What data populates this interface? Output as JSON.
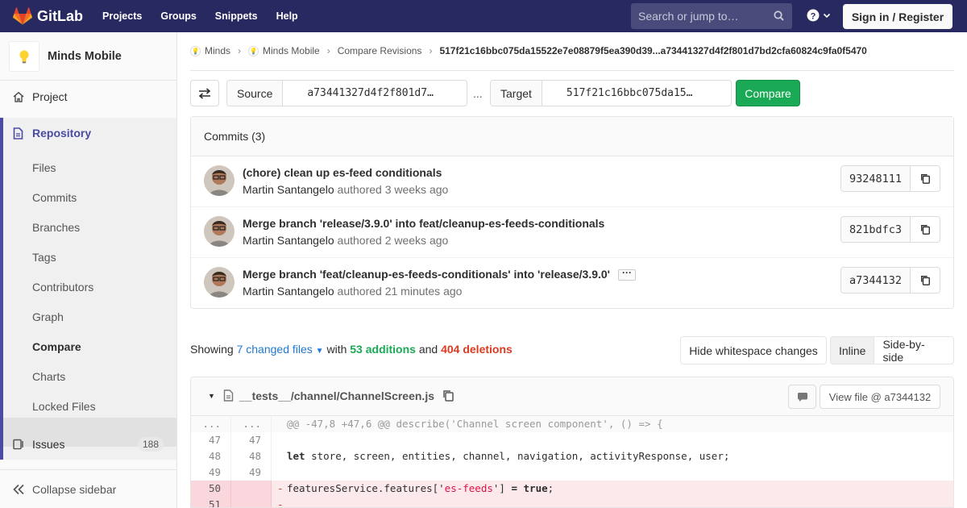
{
  "colors": {
    "topbar": "#292961",
    "accent": "#4b4ba3",
    "compare_btn": "#1aaa55",
    "additions": "#1aaa55",
    "deletions": "#db3b21",
    "link": "#1f78d1"
  },
  "topbar": {
    "brand": "GitLab",
    "nav": [
      "Projects",
      "Groups",
      "Snippets",
      "Help"
    ],
    "search_placeholder": "Search or jump to…",
    "signin": "Sign in / Register"
  },
  "sidebar": {
    "project_name": "Minds Mobile",
    "project": "Project",
    "repository": "Repository",
    "repo_items": [
      "Files",
      "Commits",
      "Branches",
      "Tags",
      "Contributors",
      "Graph",
      "Compare",
      "Charts",
      "Locked Files"
    ],
    "issues": "Issues",
    "issues_count": "188",
    "collapse": "Collapse sidebar"
  },
  "breadcrumb": {
    "items": [
      "Minds",
      "Minds Mobile",
      "Compare Revisions"
    ],
    "current": "517f21c16bbc075da15522e7e08879f5ea390d39...a73441327d4f2f801d7bd2cfa60824c9fa0f5470"
  },
  "compare_form": {
    "source_label": "Source",
    "source_value": "a73441327d4f2f801d7…",
    "dots": "...",
    "target_label": "Target",
    "target_value": "517f21c16bbc075da15…",
    "button": "Compare"
  },
  "commits": {
    "header": "Commits (3)",
    "authored": "authored",
    "list": [
      {
        "title": "(chore) clean up es-feed conditionals",
        "author": "Martin Santangelo",
        "age": "3 weeks ago",
        "sha": "93248111"
      },
      {
        "title": "Merge branch 'release/3.9.0' into feat/cleanup-es-feeds-conditionals",
        "author": "Martin Santangelo",
        "age": "2 weeks ago",
        "sha": "821bdfc3"
      },
      {
        "title": "Merge branch 'feat/cleanup-es-feeds-conditionals' into 'release/3.9.0'",
        "author": "Martin Santangelo",
        "age": "21 minutes ago",
        "sha": "a7344132"
      }
    ]
  },
  "diff_summary": {
    "showing": "Showing",
    "files": "7 changed files",
    "with": "with",
    "additions": "53 additions",
    "and": "and",
    "deletions": "404 deletions",
    "whitespace_btn": "Hide whitespace changes",
    "inline": "Inline",
    "side_by_side": "Side-by-side"
  },
  "file": {
    "path": "__tests__/channel/ChannelScreen.js",
    "view_file": "View file @ a7344132",
    "lines": [
      {
        "old": "...",
        "new": "...",
        "sign": "",
        "code": "@@ -47,8 +47,6 @@ describe('Channel screen component', () => {"
      },
      {
        "old": "47",
        "new": "47",
        "sign": "",
        "code": ""
      },
      {
        "old": "48",
        "new": "48",
        "sign": "",
        "code": "let store, screen, entities, channel, navigation, activityResponse, user;"
      },
      {
        "old": "49",
        "new": "49",
        "sign": "",
        "code": ""
      },
      {
        "old": "50",
        "new": "",
        "sign": "-",
        "code": "featuresService.features['es-feeds'] = true;"
      },
      {
        "old": "51",
        "new": "",
        "sign": "-",
        "code": ""
      }
    ]
  }
}
